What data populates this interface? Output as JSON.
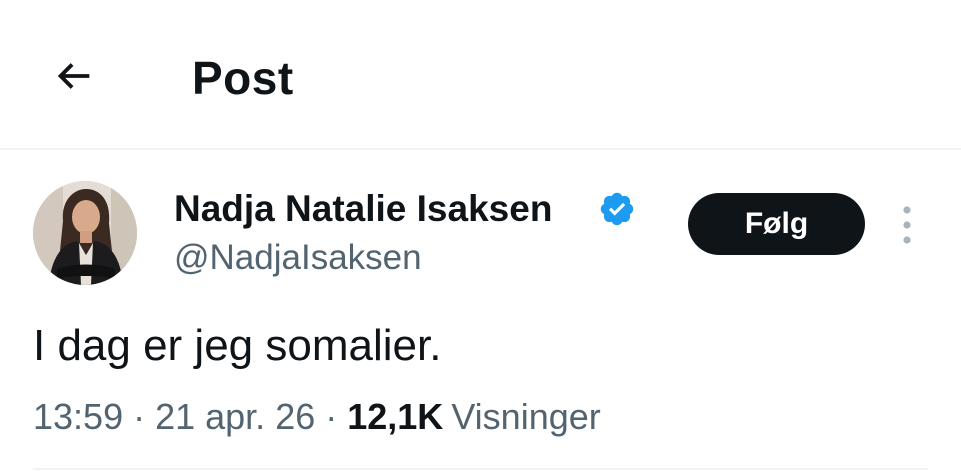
{
  "header": {
    "title": "Post"
  },
  "author": {
    "name": "Nadja Natalie Isaksen",
    "handle": "@NadjaIsaksen",
    "verified": true
  },
  "actions": {
    "follow_label": "Følg"
  },
  "post": {
    "text": "I dag er jeg somalier.",
    "time": "13:59",
    "separator": "·",
    "date": "21 apr. 26",
    "views_count": "12,1K",
    "views_label": "Visninger"
  },
  "colors": {
    "text_primary": "#0f1419",
    "text_secondary": "#536471",
    "verified_blue": "#1d9bf0",
    "divider": "#eff3f4",
    "follow_bg": "#0f1419"
  },
  "icons": {
    "back": "arrow-left-icon",
    "verified": "verified-badge-icon",
    "more": "more-vertical-icon"
  }
}
